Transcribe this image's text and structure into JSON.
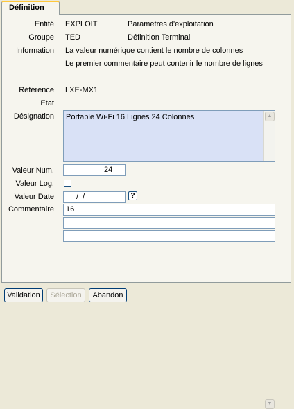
{
  "tab": {
    "label": "Définition"
  },
  "fields": {
    "entite": {
      "label": "Entité",
      "code": "EXPLOIT",
      "desc": "Parametres d'exploitation"
    },
    "groupe": {
      "label": "Groupe",
      "code": "TED",
      "desc": "Définition Terminal"
    },
    "information": {
      "label": "Information",
      "line1": "La valeur numérique contient le nombre de colonnes",
      "line2": "Le premier commentaire peut contenir le nombre de lignes"
    },
    "reference": {
      "label": "Référence",
      "value": "LXE-MX1"
    },
    "etat": {
      "label": "Etat",
      "value": ""
    },
    "designation": {
      "label": "Désignation",
      "value": "Portable Wi-Fi 16 Lignes 24 Colonnes"
    },
    "valeur_num": {
      "label": "Valeur Num.",
      "value": "24"
    },
    "valeur_log": {
      "label": "Valeur Log.",
      "checked": false
    },
    "valeur_date": {
      "label": "Valeur Date",
      "value": "/  /"
    },
    "commentaire": {
      "label": "Commentaire",
      "line1": "16",
      "line2": "",
      "line3": ""
    }
  },
  "buttons": {
    "validation": "Validation",
    "selection": "Sélection",
    "abandon": "Abandon"
  },
  "icons": {
    "help": "?",
    "scroll_up": "▲",
    "scroll_down": "▼"
  }
}
